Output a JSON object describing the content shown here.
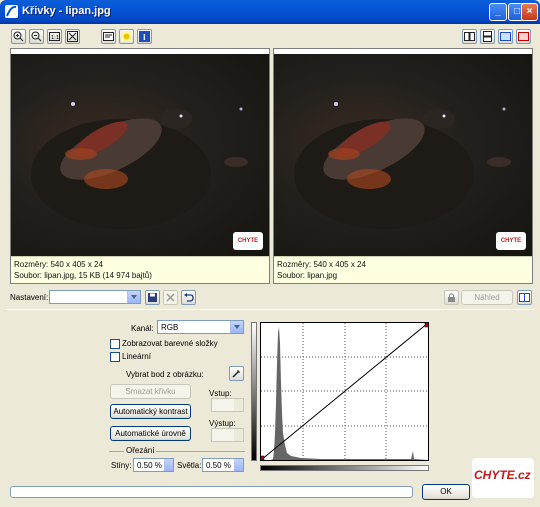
{
  "window": {
    "title": "Křivky - lipan.jpg"
  },
  "panes": {
    "original": {
      "dims": "Rozměry: 540 x 405 x 24",
      "file": "Soubor: lipan.jpg, 15 KB (14 974 bajtů)"
    },
    "preview": {
      "dims": "Rozměry: 540 x 405 x 24",
      "file": "Soubor: lipan.jpg"
    },
    "watermark": "CHYTE"
  },
  "settings": {
    "label": "Nastavení:",
    "value": "",
    "preview_label": "Náhled"
  },
  "channel": {
    "label": "Kanál:",
    "value": "RGB",
    "show_color_label": "Zobrazovat barevné složky",
    "linear_label": "Lineární",
    "pick_point_label": "Vybrat bod z obrázku:"
  },
  "actions": {
    "delete_curve": "Smazat křivku",
    "auto_contrast": "Automatický kontrast",
    "auto_levels": "Automatické úrovně"
  },
  "io": {
    "input_label": "Vstup:",
    "output_label": "Výstup:",
    "input_value": "",
    "output_value": ""
  },
  "clipping": {
    "group_label": "Ořezání",
    "shadows_label": "Stíny:",
    "shadows_value": "0.50 %",
    "highlights_label": "Světla:",
    "highlights_value": "0.50 %"
  },
  "footer": {
    "ok_label": "OK",
    "progress": 0,
    "logo_text": "CHYTE.cz"
  },
  "colors": {
    "accent": "#0454d6",
    "info_bg": "#ffffe1",
    "curve_point": "#c00000"
  }
}
